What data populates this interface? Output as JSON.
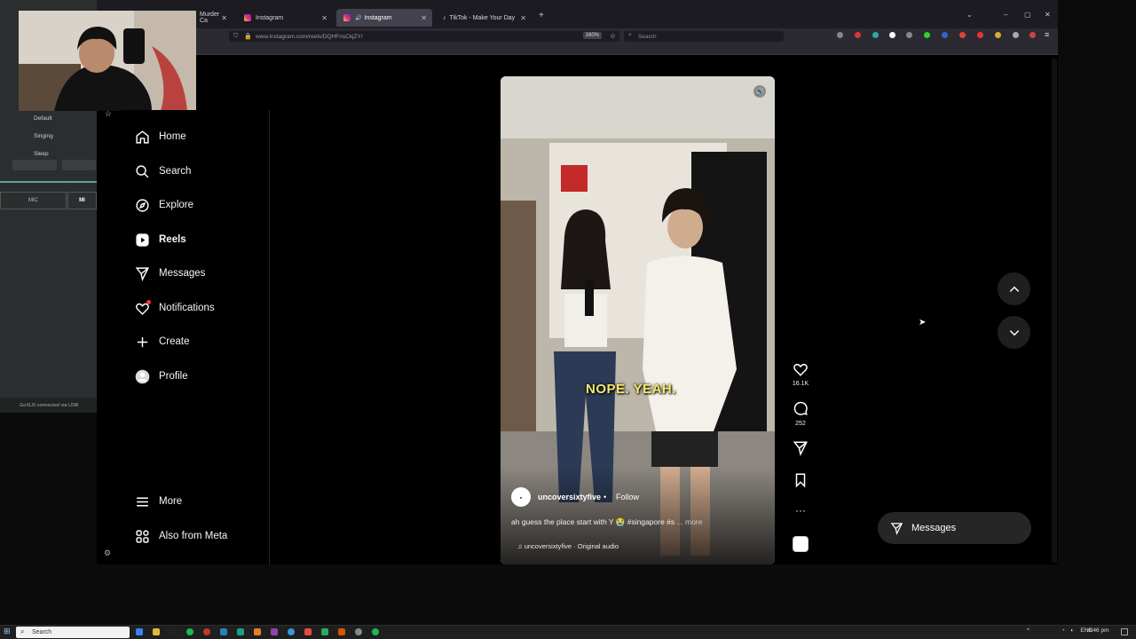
{
  "browser": {
    "tabs": [
      {
        "label": "Murder Ca",
        "active": false
      },
      {
        "label": "Instagram",
        "active": false
      },
      {
        "label": "Instagram",
        "active": true
      },
      {
        "label": "TikTok - Make Your Day",
        "active": false
      }
    ],
    "url": "www.instagram.com/reels/DQHFnsCkjZY/",
    "zoom": "160%",
    "search_placeholder": "Search"
  },
  "stream_overlay": {
    "presets": [
      "Default",
      "Singing",
      "Sleep"
    ],
    "mic_label": "MIC",
    "mic_label_short": "MI",
    "status": "GoXLR connected via USB"
  },
  "sidebar": {
    "items": [
      {
        "label": "Home",
        "icon": "home-icon"
      },
      {
        "label": "Search",
        "icon": "search-icon"
      },
      {
        "label": "Explore",
        "icon": "compass-icon"
      },
      {
        "label": "Reels",
        "icon": "reels-icon",
        "active": true
      },
      {
        "label": "Messages",
        "icon": "send-icon"
      },
      {
        "label": "Notifications",
        "icon": "heart-icon"
      },
      {
        "label": "Create",
        "icon": "plus-icon"
      },
      {
        "label": "Profile",
        "icon": "avatar-icon"
      }
    ],
    "bottom": [
      {
        "label": "More",
        "icon": "menu-icon"
      },
      {
        "label": "Also from Meta",
        "icon": "grid-icon"
      }
    ]
  },
  "reel": {
    "caption_overlay": "NOPE. YEAH.",
    "author": "uncoversixtyfive",
    "separator": "•",
    "follow_label": "Follow",
    "description": "ah guess the place start with Y 😭 #singapore #s",
    "more_label": "... more",
    "audio": "uncoversixtyfive · Original audio",
    "likes": "16.1K",
    "comments": "252"
  },
  "messages_button": "Messages",
  "taskbar": {
    "search_placeholder": "Search",
    "lang": "ENG",
    "time": "6:46 pm"
  },
  "colors": {
    "accent_blue": "#0095f6",
    "notification_dot": "#ff3040",
    "caption_yellow": "#f7e96a"
  }
}
